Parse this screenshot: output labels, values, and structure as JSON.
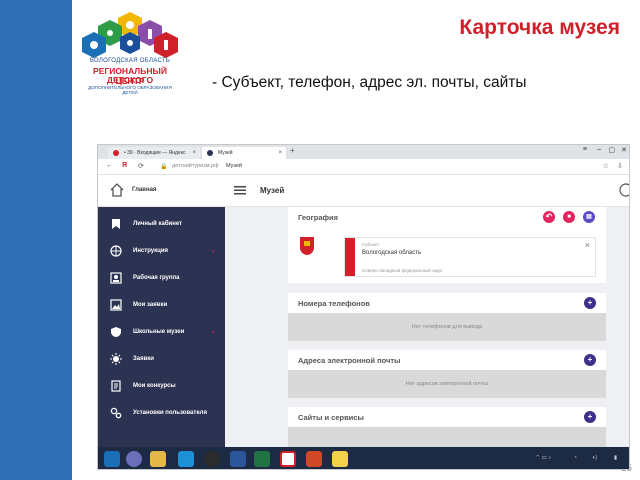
{
  "slide": {
    "title": "Карточка музея",
    "subtitle": "- Субъект, телефон, адрес эл. почты, сайты",
    "page_number": "15",
    "band_color": "#2f6fb5",
    "accent_color": "#d0202a"
  },
  "logo": {
    "line1": "ВОЛОГОДСКАЯ ОБЛАСТЬ",
    "line2": "РЕГИОНАЛЬНЫЙ ЦЕНТР",
    "line3": "ДОПОЛНИТЕЛЬНОГО ОБРАЗОВАНИЯ ДЕТЕЙ"
  },
  "browser": {
    "tabs": [
      {
        "label": "• 39 · Входящие — Яндекс",
        "icon": "mail-icon",
        "active": false
      },
      {
        "label": "Музей",
        "icon": "site-icon",
        "active": true
      }
    ],
    "address": {
      "domain": "детскийтуризм.рф",
      "page": "Музей"
    }
  },
  "app": {
    "home_label": "Главная",
    "header_title": "Музей",
    "sidebar_color": "#2c3352",
    "sidebar": [
      {
        "label": "Личный кабинет",
        "icon": "bookmark-icon",
        "expandable": false
      },
      {
        "label": "Инструкция",
        "icon": "globe-icon",
        "expandable": true
      },
      {
        "label": "Рабочая группа",
        "icon": "user-card-icon",
        "expandable": false
      },
      {
        "label": "Мои заявки",
        "icon": "image-icon",
        "expandable": false
      },
      {
        "label": "Школьные музеи",
        "icon": "shield-icon",
        "expandable": true
      },
      {
        "label": "Заявки",
        "icon": "sun-gear-icon",
        "expandable": false
      },
      {
        "label": "Мои конкурсы",
        "icon": "document-icon",
        "expandable": false
      },
      {
        "label": "Установки пользователя",
        "icon": "gears-icon",
        "expandable": false
      }
    ],
    "geography": {
      "title": "География",
      "subject_label": "Субъект",
      "subject_value": "Вологодская область",
      "district": "Северо-Западный федеральный округ"
    },
    "phones": {
      "title": "Номера телефонов",
      "empty": "Нет телефонов для вывода"
    },
    "emails": {
      "title": "Адреса электронной почты",
      "empty": "Нет адресов электронной почты"
    },
    "sites": {
      "title": "Сайты и сервисы"
    }
  },
  "taskbar": {
    "apps": [
      "start-icon",
      "search-icon",
      "explorer-icon",
      "edge-icon",
      "media-icon",
      "word-icon",
      "excel-icon",
      "yandex-icon",
      "powerpoint-icon",
      "notes-icon"
    ]
  }
}
